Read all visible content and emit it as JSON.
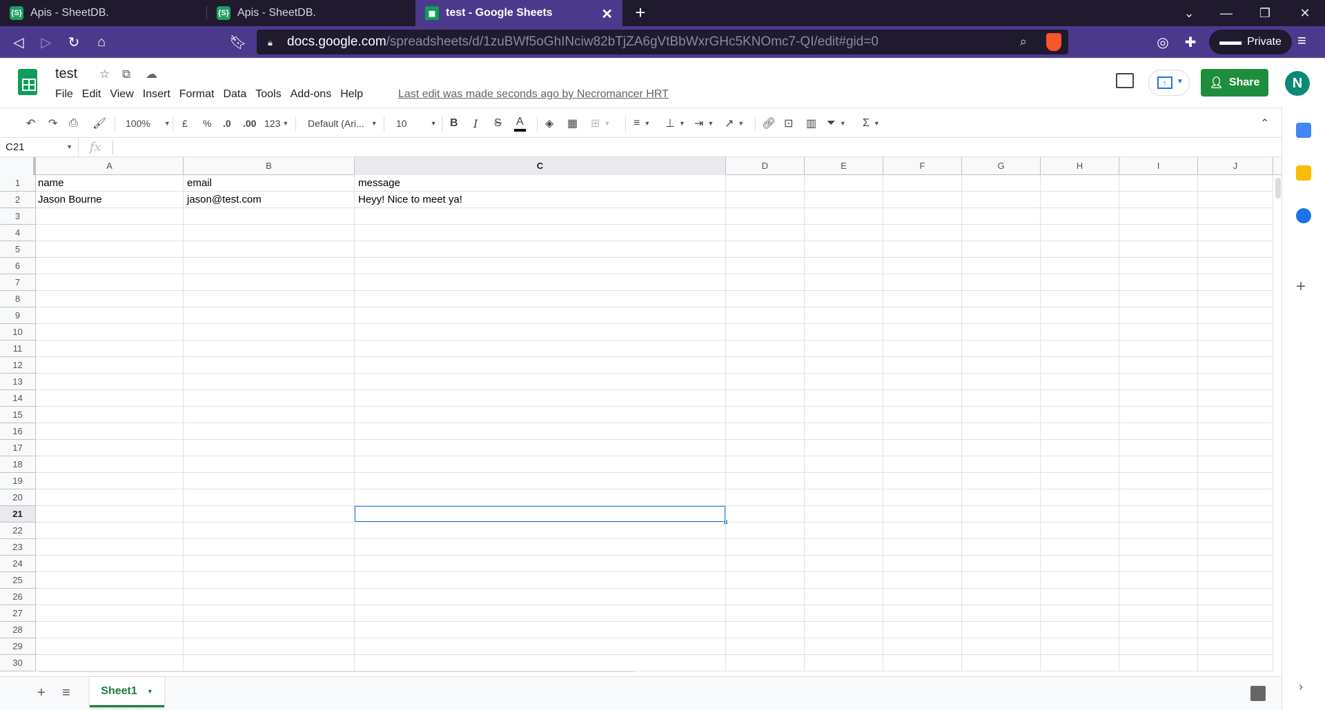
{
  "browser": {
    "tabs": [
      {
        "title": "Apis - SheetDB.",
        "active": false
      },
      {
        "title": "Apis - SheetDB.",
        "active": false
      },
      {
        "title": "test - Google Sheets",
        "active": true
      }
    ],
    "url_host": "docs.google.com",
    "url_path": "/spreadsheets/d/1zuBWf5oGhINciw82bTjZA6gVtBbWxrGHc5KNOmc7-QI/edit#gid=0",
    "private_label": "Private",
    "colors": {
      "tabstrip": "#1f1a2e",
      "toolbar": "#4b3a8c"
    }
  },
  "sheets": {
    "doc_title": "test",
    "menu": [
      "File",
      "Edit",
      "View",
      "Insert",
      "Format",
      "Data",
      "Tools",
      "Add-ons",
      "Help"
    ],
    "last_edit": "Last edit was made seconds ago by Necromancer HRT",
    "share_label": "Share",
    "avatar_initial": "N",
    "toolbar": {
      "zoom": "100%",
      "currency": "£",
      "percent": "%",
      "dec_less": ".0",
      "dec_more": ".00",
      "more_formats": "123",
      "font": "Default (Ari...",
      "font_size": "10",
      "bold": "B",
      "italic": "I",
      "strike": "S",
      "text_color": "A",
      "function": "Σ"
    },
    "name_box": "C21",
    "fx": "fx",
    "columns": [
      "A",
      "B",
      "C",
      "D",
      "E",
      "F",
      "G",
      "H",
      "I",
      "J"
    ],
    "selected_column": "C",
    "selected_row": 21,
    "row_count": 30,
    "cells": {
      "A1": "name",
      "B1": "email",
      "C1": "message",
      "A2": "Jason Bourne",
      "B2": "jason@test.com",
      "C2": "Heyy! Nice to meet ya!"
    },
    "sheet_tab": "Sheet1",
    "accent": "#0f9d58",
    "selection_color": "#1a73e8"
  }
}
